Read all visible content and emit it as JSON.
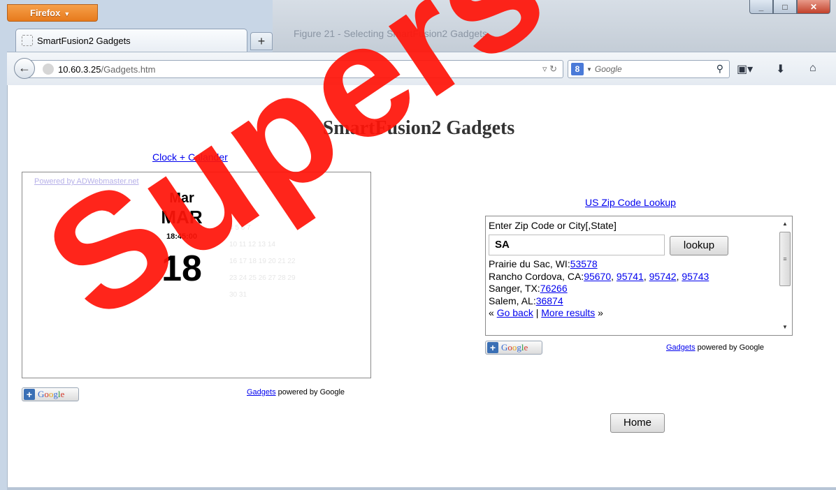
{
  "browser": {
    "menu_button": "Firefox",
    "tab_title": "SmartFusion2 Gadgets",
    "new_tab": "+",
    "url_host": "10.60.3.25",
    "url_path": "/Gadgets.htm",
    "search_engine_letter": "8",
    "search_placeholder": "Google",
    "background_text": "Figure 21 -   Selecting SmartFusion2 Gadgets"
  },
  "page": {
    "title": "SmartFusion2 Gadgets",
    "home_label": "Home"
  },
  "clock": {
    "link": "Clock + Calander",
    "powered": "Powered by ADWebmaster.net",
    "month_title": "Mar",
    "month_upper": "MAR",
    "time": "18:45:00",
    "day": "18",
    "calendar_ghost_rows": [
      "4  5  6  7",
      "10 11 12 13 14",
      "16 17 18 19 20 21 22",
      "23 24 25 26 27 28 29",
      "30 31"
    ]
  },
  "zip": {
    "link": "US Zip Code Lookup",
    "prompt": "Enter Zip Code or City[,State]",
    "input_value": "SA",
    "lookup_label": "lookup",
    "results": [
      {
        "place": "Prairie du Sac, WI:",
        "zips": [
          "53578"
        ]
      },
      {
        "place": "Rancho Cordova, CA:",
        "zips": [
          "95670",
          "95741",
          "95742",
          "95743"
        ]
      },
      {
        "place": "Sanger, TX:",
        "zips": [
          "76266"
        ]
      },
      {
        "place": "Salem, AL:",
        "zips": [
          "36874"
        ]
      }
    ],
    "go_back": "Go back",
    "more_results": "More results"
  },
  "gadgets_footer": {
    "google_word": "Google",
    "gadgets_link": "Gadgets",
    "powered_suffix": " powered by Google"
  },
  "watermark": "Superseded",
  "colors": {
    "firefox_orange": "#e77a1c",
    "link_blue": "#0000ee",
    "watermark_red": "#ff140a"
  }
}
